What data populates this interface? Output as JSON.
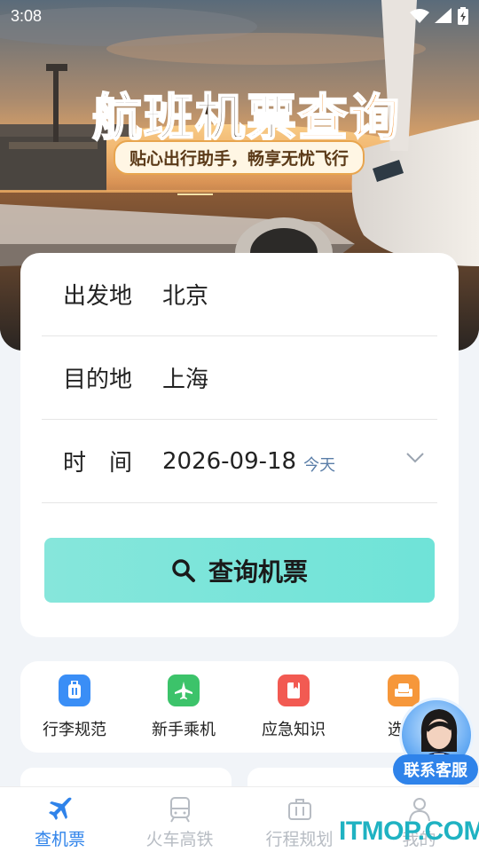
{
  "status_bar": {
    "time": "3:08"
  },
  "hero": {
    "title_part1": "航班机票",
    "title_part2": "查询",
    "subtitle": "贴心出行助手，畅享无忧飞行"
  },
  "search": {
    "departure_label": "出发地",
    "departure_value": "北京",
    "destination_label": "目的地",
    "destination_value": "上海",
    "time_label": "时　间",
    "date_value": "2026-09-18",
    "date_tag": "今天",
    "button_label": "查询机票"
  },
  "quick_links": [
    {
      "label": "行李规范",
      "icon": "luggage-icon",
      "color": "#3a8ef6"
    },
    {
      "label": "新手乘机",
      "icon": "airplane-icon",
      "color": "#3cc36a"
    },
    {
      "label": "应急知识",
      "icon": "book-icon",
      "color": "#f25a52"
    },
    {
      "label": "选座",
      "icon": "seat-icon",
      "color": "#f6973a"
    }
  ],
  "service": {
    "label": "联系客服"
  },
  "tabs": [
    {
      "label": "查机票",
      "icon": "airplane-icon",
      "active": true
    },
    {
      "label": "火车高铁",
      "icon": "train-icon",
      "active": false
    },
    {
      "label": "行程规划",
      "icon": "briefcase-icon",
      "active": false
    },
    {
      "label": "我的",
      "icon": "user-icon",
      "active": false
    }
  ],
  "watermark": "ITMOP.COM",
  "colors": {
    "accent": "#2f83ea",
    "button": "#6fe3d8",
    "date_tag": "#5a7ea8"
  }
}
